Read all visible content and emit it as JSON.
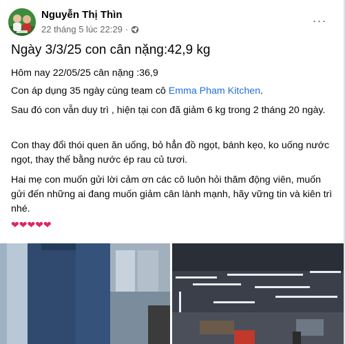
{
  "post": {
    "author": "Nguyễn Thị Thìn",
    "timestamp": "22 tháng 5 lúc 22:29",
    "separator": "·",
    "visibility_icon": "globe-icon",
    "more_icon": "more-horizontal-icon",
    "more_label": "···",
    "title": "Ngày 3/3/25 con cân nặng:42,9 kg",
    "paragraphs": {
      "p1": "Hôm nay 22/05/25 cân nặng :36,9",
      "p2_before": "Con áp dụng 35 ngày cùng team cô ",
      "p2_mention": "Emma Pham Kitchen",
      "p2_after": ".",
      "p3": "Sau đó con vẫn duy trì , hiện tại con đã giảm 6 kg trong 2 tháng 20 ngày.",
      "p4": "Con thay đổi thói quen ăn uống, bỏ hẳn đồ ngọt, bánh kẹo, ko uống nước ngọt, thay thế bằng nước ép rau củ tươi.",
      "p5": "Hai mẹ con muốn gửi lời cảm ơn các cô luôn hỏi thăm động viên, muốn gửi đến những ai đang muốn giảm cân lành mạnh, hãy vững tin và kiên trì nhé."
    },
    "hearts": "❤❤❤❤❤"
  },
  "colors": {
    "mention": "#216fdb",
    "secondary_text": "#65676b",
    "heart": "#e0245e"
  }
}
